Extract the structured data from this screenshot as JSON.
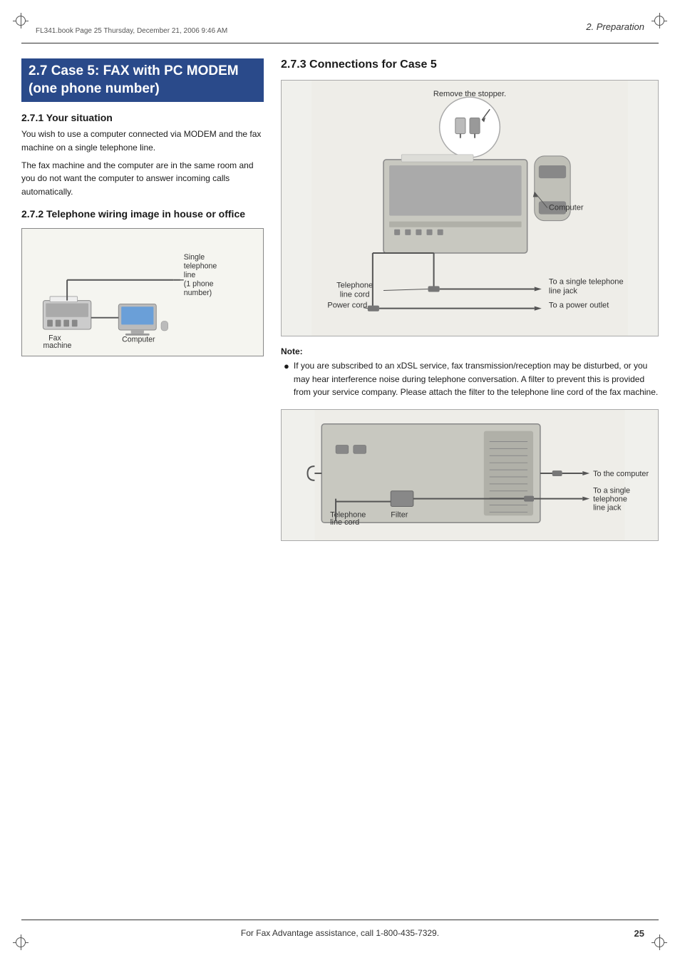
{
  "page": {
    "header": "2. Preparation",
    "footer_text": "For Fax Advantage assistance, call 1-800-435-7329.",
    "footer_page": "25",
    "file_info": "FL341.book  Page 25  Thursday, December 21, 2006  9:46 AM"
  },
  "left": {
    "section_title": "2.7 Case 5: FAX with PC MODEM (one phone number)",
    "sub1_title": "2.7.1 Your situation",
    "sub1_para1": "You wish to use a computer connected via MODEM and the fax machine on a single telephone line.",
    "sub1_para2": "The fax machine and the computer are in the same room and you do not want the computer to answer incoming calls automatically.",
    "sub2_title": "2.7.2 Telephone wiring image in house or office",
    "wiring_label_single": "Single telephone line (1 phone number)",
    "wiring_label_fax": "Fax machine",
    "wiring_label_computer": "Computer"
  },
  "right": {
    "section_title": "2.7.3 Connections for Case 5",
    "diagram_label_remove": "Remove the stopper.",
    "diagram_label_computer": "Computer",
    "diagram_label_tel_cord": "Telephone line cord",
    "diagram_label_single_jack": "To a single telephone line jack",
    "diagram_label_power": "To a power outlet",
    "diagram_label_power_cord": "Power cord",
    "note_label": "Note:",
    "note_text": "If you are subscribed to an xDSL service, fax transmission/reception may be disturbed, or you may hear interference noise during telephone conversation. A filter to prevent this is provided from your service company. Please attach the filter to the telephone line cord of the fax machine.",
    "filter_label_to_computer": "To the computer",
    "filter_label_single_jack": "To a single telephone line jack",
    "filter_label_tel_cord": "Telephone line cord",
    "filter_label_filter": "Filter"
  }
}
